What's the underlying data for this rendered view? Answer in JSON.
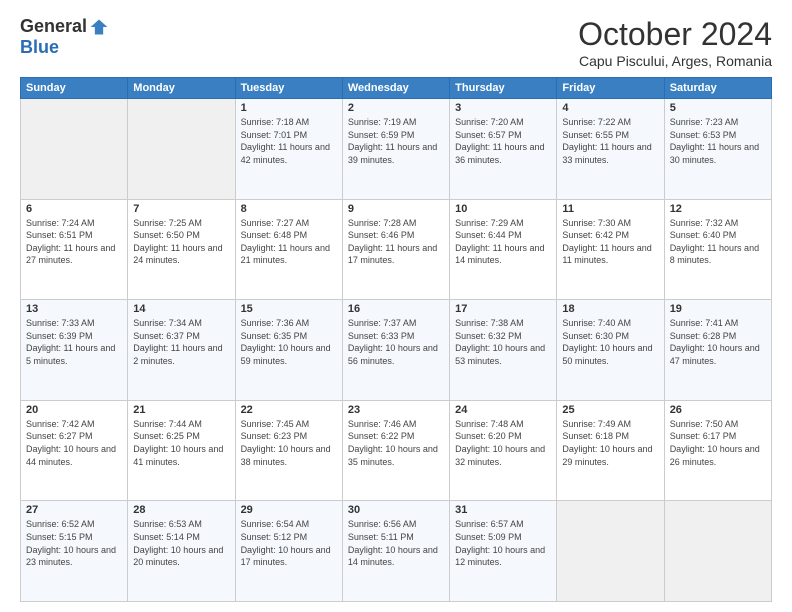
{
  "logo": {
    "general": "General",
    "blue": "Blue"
  },
  "header": {
    "month": "October 2024",
    "location": "Capu Piscului, Arges, Romania"
  },
  "days_of_week": [
    "Sunday",
    "Monday",
    "Tuesday",
    "Wednesday",
    "Thursday",
    "Friday",
    "Saturday"
  ],
  "weeks": [
    [
      {
        "day": "",
        "empty": true
      },
      {
        "day": "",
        "empty": true
      },
      {
        "day": "1",
        "sunrise": "7:18 AM",
        "sunset": "7:01 PM",
        "daylight": "11 hours and 42 minutes."
      },
      {
        "day": "2",
        "sunrise": "7:19 AM",
        "sunset": "6:59 PM",
        "daylight": "11 hours and 39 minutes."
      },
      {
        "day": "3",
        "sunrise": "7:20 AM",
        "sunset": "6:57 PM",
        "daylight": "11 hours and 36 minutes."
      },
      {
        "day": "4",
        "sunrise": "7:22 AM",
        "sunset": "6:55 PM",
        "daylight": "11 hours and 33 minutes."
      },
      {
        "day": "5",
        "sunrise": "7:23 AM",
        "sunset": "6:53 PM",
        "daylight": "11 hours and 30 minutes."
      }
    ],
    [
      {
        "day": "6",
        "sunrise": "7:24 AM",
        "sunset": "6:51 PM",
        "daylight": "11 hours and 27 minutes."
      },
      {
        "day": "7",
        "sunrise": "7:25 AM",
        "sunset": "6:50 PM",
        "daylight": "11 hours and 24 minutes."
      },
      {
        "day": "8",
        "sunrise": "7:27 AM",
        "sunset": "6:48 PM",
        "daylight": "11 hours and 21 minutes."
      },
      {
        "day": "9",
        "sunrise": "7:28 AM",
        "sunset": "6:46 PM",
        "daylight": "11 hours and 17 minutes."
      },
      {
        "day": "10",
        "sunrise": "7:29 AM",
        "sunset": "6:44 PM",
        "daylight": "11 hours and 14 minutes."
      },
      {
        "day": "11",
        "sunrise": "7:30 AM",
        "sunset": "6:42 PM",
        "daylight": "11 hours and 11 minutes."
      },
      {
        "day": "12",
        "sunrise": "7:32 AM",
        "sunset": "6:40 PM",
        "daylight": "11 hours and 8 minutes."
      }
    ],
    [
      {
        "day": "13",
        "sunrise": "7:33 AM",
        "sunset": "6:39 PM",
        "daylight": "11 hours and 5 minutes."
      },
      {
        "day": "14",
        "sunrise": "7:34 AM",
        "sunset": "6:37 PM",
        "daylight": "11 hours and 2 minutes."
      },
      {
        "day": "15",
        "sunrise": "7:36 AM",
        "sunset": "6:35 PM",
        "daylight": "10 hours and 59 minutes."
      },
      {
        "day": "16",
        "sunrise": "7:37 AM",
        "sunset": "6:33 PM",
        "daylight": "10 hours and 56 minutes."
      },
      {
        "day": "17",
        "sunrise": "7:38 AM",
        "sunset": "6:32 PM",
        "daylight": "10 hours and 53 minutes."
      },
      {
        "day": "18",
        "sunrise": "7:40 AM",
        "sunset": "6:30 PM",
        "daylight": "10 hours and 50 minutes."
      },
      {
        "day": "19",
        "sunrise": "7:41 AM",
        "sunset": "6:28 PM",
        "daylight": "10 hours and 47 minutes."
      }
    ],
    [
      {
        "day": "20",
        "sunrise": "7:42 AM",
        "sunset": "6:27 PM",
        "daylight": "10 hours and 44 minutes."
      },
      {
        "day": "21",
        "sunrise": "7:44 AM",
        "sunset": "6:25 PM",
        "daylight": "10 hours and 41 minutes."
      },
      {
        "day": "22",
        "sunrise": "7:45 AM",
        "sunset": "6:23 PM",
        "daylight": "10 hours and 38 minutes."
      },
      {
        "day": "23",
        "sunrise": "7:46 AM",
        "sunset": "6:22 PM",
        "daylight": "10 hours and 35 minutes."
      },
      {
        "day": "24",
        "sunrise": "7:48 AM",
        "sunset": "6:20 PM",
        "daylight": "10 hours and 32 minutes."
      },
      {
        "day": "25",
        "sunrise": "7:49 AM",
        "sunset": "6:18 PM",
        "daylight": "10 hours and 29 minutes."
      },
      {
        "day": "26",
        "sunrise": "7:50 AM",
        "sunset": "6:17 PM",
        "daylight": "10 hours and 26 minutes."
      }
    ],
    [
      {
        "day": "27",
        "sunrise": "6:52 AM",
        "sunset": "5:15 PM",
        "daylight": "10 hours and 23 minutes."
      },
      {
        "day": "28",
        "sunrise": "6:53 AM",
        "sunset": "5:14 PM",
        "daylight": "10 hours and 20 minutes."
      },
      {
        "day": "29",
        "sunrise": "6:54 AM",
        "sunset": "5:12 PM",
        "daylight": "10 hours and 17 minutes."
      },
      {
        "day": "30",
        "sunrise": "6:56 AM",
        "sunset": "5:11 PM",
        "daylight": "10 hours and 14 minutes."
      },
      {
        "day": "31",
        "sunrise": "6:57 AM",
        "sunset": "5:09 PM",
        "daylight": "10 hours and 12 minutes."
      },
      {
        "day": "",
        "empty": true
      },
      {
        "day": "",
        "empty": true
      }
    ]
  ]
}
